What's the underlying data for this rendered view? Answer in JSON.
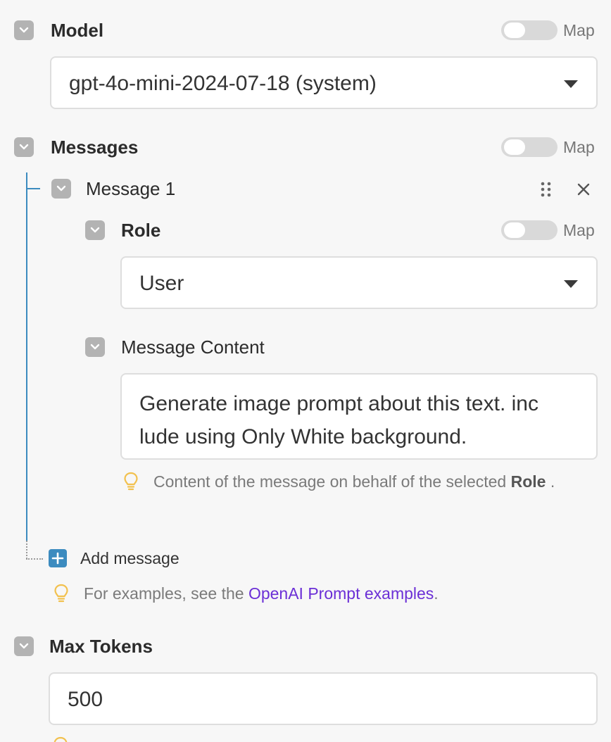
{
  "model": {
    "label": "Model",
    "map_label": "Map",
    "selected": "gpt-4o-mini-2024-07-18 (system)"
  },
  "messages": {
    "label": "Messages",
    "map_label": "Map",
    "items": [
      {
        "title": "Message 1",
        "role": {
          "label": "Role",
          "map_label": "Map",
          "selected": "User"
        },
        "content": {
          "label": "Message Content",
          "line1": "Generate image prompt about this text. inc",
          "line2": "lude using Only White background.",
          "hint_prefix": "Content of the message on behalf of the selected ",
          "hint_bold": "Role",
          "hint_suffix": " ."
        }
      }
    ],
    "add_label": "Add message",
    "examples_prefix": "For examples, see the ",
    "examples_link": "OpenAI Prompt examples",
    "examples_suffix": "."
  },
  "max_tokens": {
    "label": "Max Tokens",
    "value": "500"
  },
  "colors": {
    "accent": "#3c8bbf",
    "link": "#6b2fd6",
    "bulb": "#f2c14e",
    "chevron_bg": "#b3b3b3"
  }
}
